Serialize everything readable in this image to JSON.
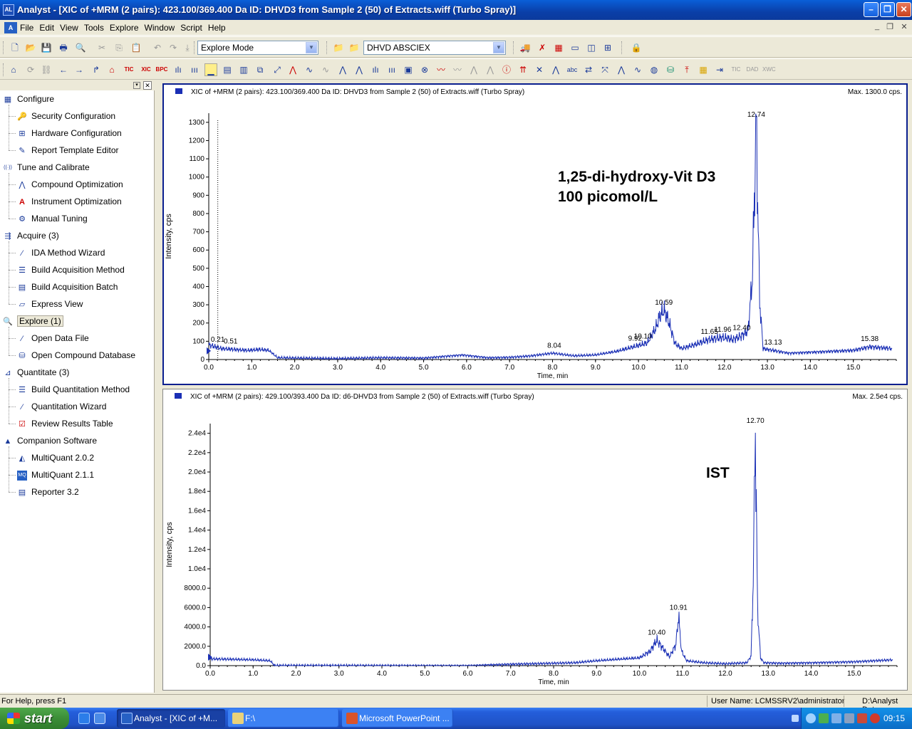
{
  "window": {
    "title": "Analyst - [XIC of +MRM (2 pairs): 423.100/369.400 Da ID: DHVD3 from Sample 2 (50) of Extracts.wiff (Turbo Spray)]",
    "app_icon": "AL"
  },
  "menu": [
    "File",
    "Edit",
    "View",
    "Tools",
    "Explore",
    "Window",
    "Script",
    "Help"
  ],
  "toolbar": {
    "mode_select": "Explore Mode",
    "project_select": "DHVD ABSCIEX",
    "tic_label": "TIC",
    "xic_label": "XIC",
    "bpc_label": "BPC"
  },
  "sidebar": {
    "items": [
      {
        "label": "Configure",
        "level": 0,
        "icon": "grid-icon"
      },
      {
        "label": "Security Configuration",
        "level": 1,
        "icon": "key-icon"
      },
      {
        "label": "Hardware Configuration",
        "level": 1,
        "icon": "hardware-icon"
      },
      {
        "label": "Report Template Editor",
        "level": 1,
        "icon": "pen-icon"
      },
      {
        "label": "Tune and Calibrate",
        "level": 0,
        "icon": "antenna-icon"
      },
      {
        "label": "Compound Optimization",
        "level": 1,
        "icon": "peak-icon"
      },
      {
        "label": "Instrument Optimization",
        "level": 1,
        "icon": "instrument-icon"
      },
      {
        "label": "Manual Tuning",
        "level": 1,
        "icon": "tuning-icon"
      },
      {
        "label": "Acquire  (3)",
        "level": 0,
        "icon": "acquire-icon"
      },
      {
        "label": "IDA Method Wizard",
        "level": 1,
        "icon": "wand-icon"
      },
      {
        "label": "Build Acquisition Method",
        "level": 1,
        "icon": "method-icon"
      },
      {
        "label": "Build Acquisition Batch",
        "level": 1,
        "icon": "batch-icon"
      },
      {
        "label": "Express View",
        "level": 1,
        "icon": "express-icon"
      },
      {
        "label": "Explore  (1)",
        "level": 0,
        "icon": "explore-icon",
        "selected": true
      },
      {
        "label": "Open Data File",
        "level": 1,
        "icon": "wand-icon"
      },
      {
        "label": "Open Compound Database",
        "level": 1,
        "icon": "database-icon"
      },
      {
        "label": "Quantitate  (3)",
        "level": 0,
        "icon": "chart-icon"
      },
      {
        "label": "Build Quantitation Method",
        "level": 1,
        "icon": "method-icon"
      },
      {
        "label": "Quantitation Wizard",
        "level": 1,
        "icon": "wand-icon"
      },
      {
        "label": "Review Results Table",
        "level": 1,
        "icon": "checklist-icon"
      },
      {
        "label": "Companion Software",
        "level": 0,
        "icon": "companion-icon"
      },
      {
        "label": "MultiQuant 2.0.2",
        "level": 1,
        "icon": "multiquant-icon"
      },
      {
        "label": "MultiQuant 2.1.1",
        "level": 1,
        "icon": "mq-icon"
      },
      {
        "label": "Reporter 3.2",
        "level": 1,
        "icon": "reporter-icon"
      }
    ]
  },
  "chart_data": [
    {
      "type": "line",
      "header": "XIC of +MRM (2 pairs): 423.100/369.400 Da ID: DHVD3 from Sample 2 (50) of Extracts.wiff (Turbo Spray)",
      "max_label": "Max. 1300.0 cps.",
      "xlabel": "Time, min",
      "ylabel": "Intensity, cps",
      "xlim": [
        0,
        16
      ],
      "ylim": [
        0,
        1350
      ],
      "xticks": [
        "0.0",
        "1.0",
        "2.0",
        "3.0",
        "4.0",
        "5.0",
        "6.0",
        "7.0",
        "8.0",
        "9.0",
        "10.0",
        "11.0",
        "12.0",
        "13.0",
        "14.0",
        "15.0"
      ],
      "yticks": [
        "0",
        "100",
        "200",
        "300",
        "400",
        "500",
        "600",
        "700",
        "800",
        "900",
        "1000",
        "1100",
        "1200",
        "1300"
      ],
      "annotation": [
        "1,25-di-hydroxy-Vit D3",
        "100 picomol/L"
      ],
      "peaks": [
        {
          "x": 0.21,
          "label": "0.21"
        },
        {
          "x": 0.51,
          "label": "0.51"
        },
        {
          "x": 8.04,
          "label": "8.04"
        },
        {
          "x": 9.92,
          "label": "9.92"
        },
        {
          "x": 10.1,
          "label": "10.10"
        },
        {
          "x": 10.59,
          "label": "10.59"
        },
        {
          "x": 11.65,
          "label": "11.65"
        },
        {
          "x": 11.96,
          "label": "11.96"
        },
        {
          "x": 12.4,
          "label": "12.40"
        },
        {
          "x": 12.74,
          "label": "12.74"
        },
        {
          "x": 13.13,
          "label": "13.13"
        },
        {
          "x": 15.38,
          "label": "15.38"
        }
      ],
      "series": [
        {
          "color": "#1a2fb5",
          "x": [
            0.0,
            0.3,
            0.6,
            0.9,
            1.2,
            1.4,
            1.6,
            2.0,
            3.0,
            4.0,
            5.0,
            5.9,
            6.5,
            7.0,
            7.5,
            8.0,
            8.5,
            9.0,
            9.5,
            9.9,
            10.2,
            10.4,
            10.5,
            10.59,
            10.7,
            10.85,
            11.0,
            11.3,
            11.65,
            11.96,
            12.2,
            12.4,
            12.55,
            12.65,
            12.74,
            12.82,
            12.9,
            13.13,
            13.5,
            14.0,
            14.5,
            15.0,
            15.38,
            15.9
          ],
          "y": [
            80,
            60,
            55,
            50,
            55,
            50,
            10,
            8,
            5,
            10,
            8,
            25,
            10,
            12,
            20,
            35,
            20,
            25,
            45,
            70,
            90,
            170,
            240,
            270,
            210,
            90,
            60,
            80,
            110,
            120,
            110,
            130,
            160,
            450,
            1300,
            320,
            60,
            50,
            35,
            40,
            45,
            50,
            70,
            60
          ]
        }
      ]
    },
    {
      "type": "line",
      "header": "XIC of +MRM (2 pairs): 429.100/393.400 Da ID: d6-DHVD3 from Sample 2 (50) of Extracts.wiff (Turbo Spray)",
      "max_label": "Max. 2.5e4 cps.",
      "xlabel": "Time, min",
      "ylabel": "Intensity, cps",
      "xlim": [
        0,
        16
      ],
      "ylim": [
        0,
        25000
      ],
      "xticks": [
        "0.0",
        "1.0",
        "2.0",
        "3.0",
        "4.0",
        "5.0",
        "6.0",
        "7.0",
        "8.0",
        "9.0",
        "10.0",
        "11.0",
        "12.0",
        "13.0",
        "14.0",
        "15.0"
      ],
      "yticks": [
        "0.0",
        "2000.0",
        "4000.0",
        "6000.0",
        "8000.0",
        "1.0e4",
        "1.2e4",
        "1.4e4",
        "1.6e4",
        "1.8e4",
        "2.0e4",
        "2.2e4",
        "2.4e4"
      ],
      "annotation": [
        "IST"
      ],
      "peaks": [
        {
          "x": 10.4,
          "label": "10.40"
        },
        {
          "x": 10.91,
          "label": "10.91"
        },
        {
          "x": 12.7,
          "label": "12.70"
        }
      ],
      "series": [
        {
          "color": "#1a2fb5",
          "x": [
            0.0,
            0.5,
            1.0,
            1.4,
            1.5,
            2.0,
            3.0,
            4.0,
            5.0,
            6.0,
            7.0,
            8.0,
            8.5,
            9.0,
            9.5,
            10.0,
            10.25,
            10.4,
            10.55,
            10.7,
            10.85,
            10.91,
            10.98,
            11.1,
            11.5,
            12.0,
            12.5,
            12.6,
            12.65,
            12.7,
            12.75,
            12.82,
            12.9,
            13.3,
            14.0,
            15.0,
            15.9
          ],
          "y": [
            700,
            650,
            600,
            500,
            0,
            0,
            0,
            0,
            0,
            0,
            150,
            250,
            300,
            500,
            650,
            800,
            1500,
            2600,
            1800,
            900,
            2200,
            5200,
            1500,
            500,
            300,
            200,
            300,
            1000,
            9000,
            24500,
            6000,
            800,
            300,
            250,
            300,
            400,
            600
          ]
        }
      ]
    }
  ],
  "status": {
    "help": "For Help, press F1",
    "user": "User Name: LCMSSRV2\\administrator",
    "path": "D:\\Analyst Data"
  },
  "taskbar": {
    "start": "start",
    "tasks": [
      "Analyst - [XIC of +M...",
      "F:\\",
      "Microsoft PowerPoint ..."
    ],
    "clock": "09:15"
  }
}
